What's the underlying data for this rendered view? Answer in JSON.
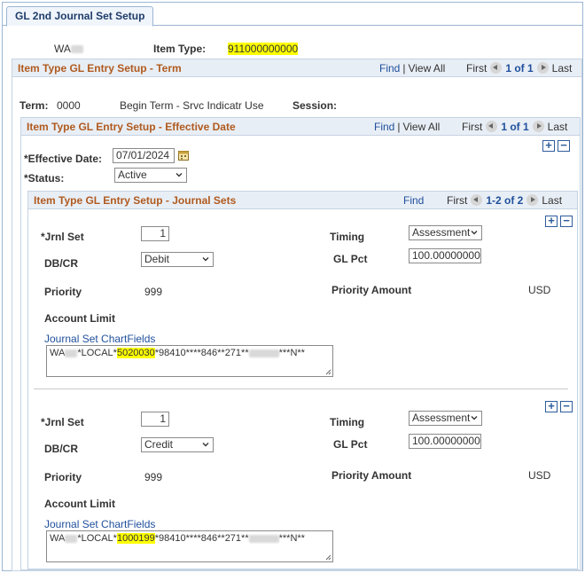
{
  "tab": "GL 2nd Journal Set Setup",
  "header": {
    "institution_prefix": "WA",
    "item_type_label": "Item Type:",
    "item_type_value": "911000000000"
  },
  "term_section": {
    "title": "Item Type GL Entry Setup - Term",
    "find": "Find",
    "view_all": "View All",
    "first": "First",
    "count": "1 of 1",
    "last": "Last",
    "term_label": "Term:",
    "term_value": "0000",
    "term_desc": "Begin Term - Srvc Indicatr Use",
    "session_label": "Session:"
  },
  "effdt_section": {
    "title": "Item Type GL Entry Setup - Effective Date",
    "find": "Find",
    "view_all": "View All",
    "first": "First",
    "count": "1 of 1",
    "last": "Last",
    "effdt_label": "*Effective Date:",
    "effdt_value": "07/01/2024",
    "status_label": "*Status:",
    "status_value": "Active"
  },
  "journal_section": {
    "title": "Item Type GL Entry Setup - Journal Sets",
    "find": "Find",
    "first": "First",
    "count": "1-2 of 2",
    "last": "Last",
    "rows": [
      {
        "jrnl_set_label": "*Jrnl Set",
        "jrnl_set_value": "1",
        "timing_label": "Timing",
        "timing_value": "Assessment",
        "dbcr_label": "DB/CR",
        "dbcr_value": "Debit",
        "glpct_label": "GL Pct",
        "glpct_value": "100.00000000",
        "priority_label": "Priority",
        "priority_value": "999",
        "priority_amount_label": "Priority Amount",
        "currency": "USD",
        "account_limit_label": "Account Limit",
        "chartfields_link": "Journal Set ChartFields",
        "cf_prefix": "WA",
        "cf_local": "*LOCAL*",
        "cf_account": "5020030",
        "cf_rest": "*98410****846**271**",
        "cf_tail": "***N**"
      },
      {
        "jrnl_set_label": "*Jrnl Set",
        "jrnl_set_value": "1",
        "timing_label": "Timing",
        "timing_value": "Assessment",
        "dbcr_label": "DB/CR",
        "dbcr_value": "Credit",
        "glpct_label": "GL Pct",
        "glpct_value": "100.00000000",
        "priority_label": "Priority",
        "priority_value": "999",
        "priority_amount_label": "Priority Amount",
        "currency": "USD",
        "account_limit_label": "Account Limit",
        "chartfields_link": "Journal Set ChartFields",
        "cf_prefix": "WA",
        "cf_local": "*LOCAL*",
        "cf_account": "1000199",
        "cf_rest": "*98410****846**271**",
        "cf_tail": "***N**"
      }
    ]
  },
  "icons": {
    "calendar": "calendar-icon",
    "add": "add-row-icon",
    "delete": "delete-row-icon",
    "prev": "previous-arrow-icon",
    "next": "next-arrow-icon",
    "chevron": "chevron-down-icon"
  },
  "colors": {
    "section_title": "#b05a1f",
    "link": "#1f4f9b",
    "highlight": "#ffff00",
    "header_bg": "#e8eef5"
  }
}
